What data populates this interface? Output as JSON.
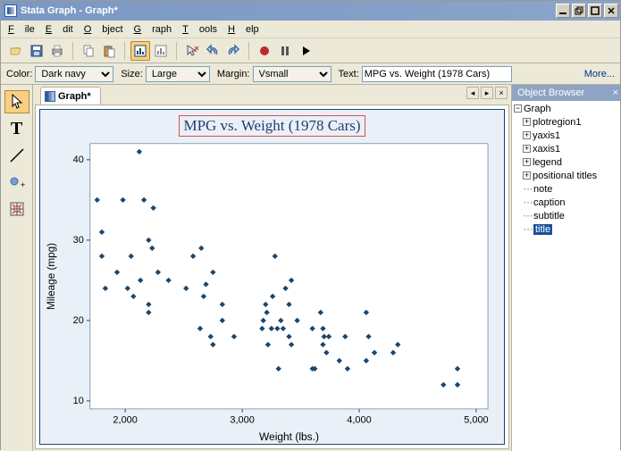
{
  "window": {
    "title": "Stata Graph - Graph*"
  },
  "menu": {
    "items": [
      "File",
      "Edit",
      "Object",
      "Graph",
      "Tools",
      "Help"
    ]
  },
  "props": {
    "color_label": "Color:",
    "color_value": "Dark navy",
    "size_label": "Size:",
    "size_value": "Large",
    "margin_label": "Margin:",
    "margin_value": "Vsmall",
    "text_label": "Text:",
    "text_value": "MPG vs. Weight (1978 Cars)",
    "more": "More..."
  },
  "tab": {
    "label": "Graph*"
  },
  "chart": {
    "title": "MPG vs. Weight (1978 Cars)",
    "xlabel": "Weight (lbs.)",
    "ylabel": "Mileage (mpg)"
  },
  "browser": {
    "title": "Object Browser",
    "root": "Graph",
    "items": [
      "plotregion1",
      "yaxis1",
      "xaxis1",
      "legend",
      "positional titles",
      "note",
      "caption",
      "subtitle",
      "title"
    ],
    "selected": "title"
  },
  "chart_data": {
    "type": "scatter",
    "title": "MPG vs. Weight (1978 Cars)",
    "xlabel": "Weight (lbs.)",
    "ylabel": "Mileage (mpg)",
    "xlim": [
      1700,
      5100
    ],
    "ylim": [
      9,
      42
    ],
    "xticks": [
      2000,
      3000,
      4000,
      5000
    ],
    "yticks": [
      10,
      20,
      30,
      40
    ],
    "points": [
      [
        1760,
        35
      ],
      [
        1800,
        31
      ],
      [
        1800,
        28
      ],
      [
        1830,
        24
      ],
      [
        1930,
        26
      ],
      [
        1980,
        35
      ],
      [
        2020,
        24
      ],
      [
        2050,
        28
      ],
      [
        2070,
        23
      ],
      [
        2120,
        41
      ],
      [
        2130,
        25
      ],
      [
        2160,
        35
      ],
      [
        2200,
        30
      ],
      [
        2200,
        22
      ],
      [
        2200,
        21
      ],
      [
        2230,
        29
      ],
      [
        2240,
        34
      ],
      [
        2280,
        26
      ],
      [
        2370,
        25
      ],
      [
        2520,
        24
      ],
      [
        2580,
        28
      ],
      [
        2640,
        19
      ],
      [
        2650,
        29
      ],
      [
        2670,
        23
      ],
      [
        2690,
        24.5
      ],
      [
        2730,
        18
      ],
      [
        2750,
        26
      ],
      [
        2750,
        17
      ],
      [
        2830,
        22
      ],
      [
        2830,
        20
      ],
      [
        2930,
        18
      ],
      [
        3170,
        19
      ],
      [
        3180,
        20
      ],
      [
        3200,
        22
      ],
      [
        3210,
        21
      ],
      [
        3220,
        17
      ],
      [
        3250,
        19
      ],
      [
        3260,
        23
      ],
      [
        3280,
        28
      ],
      [
        3300,
        19
      ],
      [
        3310,
        14
      ],
      [
        3330,
        20
      ],
      [
        3350,
        19
      ],
      [
        3370,
        24
      ],
      [
        3400,
        22
      ],
      [
        3400,
        18
      ],
      [
        3420,
        25
      ],
      [
        3420,
        17
      ],
      [
        3470,
        20
      ],
      [
        3600,
        14
      ],
      [
        3600,
        19
      ],
      [
        3620,
        14
      ],
      [
        3670,
        21
      ],
      [
        3690,
        19
      ],
      [
        3690,
        17
      ],
      [
        3700,
        18
      ],
      [
        3720,
        16
      ],
      [
        3740,
        18
      ],
      [
        3830,
        15
      ],
      [
        3880,
        18
      ],
      [
        3900,
        14
      ],
      [
        4060,
        15
      ],
      [
        4060,
        21
      ],
      [
        4080,
        18
      ],
      [
        4130,
        16
      ],
      [
        4290,
        16
      ],
      [
        4330,
        17
      ],
      [
        4720,
        12
      ],
      [
        4840,
        14
      ],
      [
        4840,
        12
      ]
    ]
  }
}
